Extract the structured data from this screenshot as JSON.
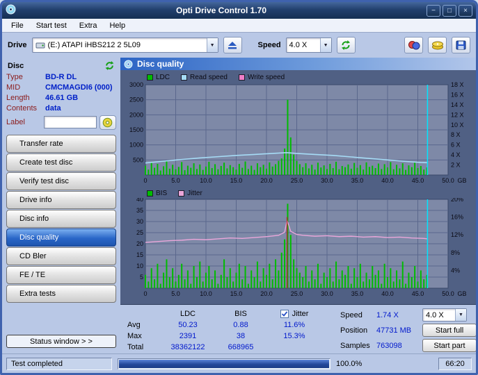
{
  "window": {
    "title": "Opti Drive Control 1.70",
    "minimize_glyph": "−",
    "maximize_glyph": "□",
    "close_glyph": "×"
  },
  "menu": {
    "items": [
      "File",
      "Start test",
      "Extra",
      "Help"
    ]
  },
  "toolbar": {
    "drive_label": "Drive",
    "drive_value": "(E:)  ATAPI iHBS212  2 5L09",
    "speed_label": "Speed",
    "speed_value": "4.0 X"
  },
  "sidebar": {
    "section_title": "Disc",
    "info": [
      {
        "label": "Type",
        "value": "BD-R DL"
      },
      {
        "label": "MID",
        "value": "CMCMAGDI6 (000)"
      },
      {
        "label": "Length",
        "value": "46.61 GB"
      },
      {
        "label": "Contents",
        "value": "data"
      }
    ],
    "label_caption": "Label",
    "label_value": "",
    "nav": [
      {
        "label": "Transfer rate",
        "active": false
      },
      {
        "label": "Create test disc",
        "active": false
      },
      {
        "label": "Verify test disc",
        "active": false
      },
      {
        "label": "Drive info",
        "active": false
      },
      {
        "label": "Disc info",
        "active": false
      },
      {
        "label": "Disc quality",
        "active": true
      },
      {
        "label": "CD Bler",
        "active": false
      },
      {
        "label": "FE / TE",
        "active": false
      },
      {
        "label": "Extra tests",
        "active": false
      }
    ],
    "status_window_label": "Status window > >"
  },
  "main": {
    "header": "Disc quality",
    "stats": {
      "col_headers": [
        "LDC",
        "BIS"
      ],
      "jitter_header": "Jitter",
      "jitter_checked": true,
      "rows": [
        {
          "label": "Avg",
          "ldc": "50.23",
          "bis": "0.88",
          "jitter": "11.6%"
        },
        {
          "label": "Max",
          "ldc": "2391",
          "bis": "38",
          "jitter": "15.3%"
        },
        {
          "label": "Total",
          "ldc": "38362122",
          "bis": "668965",
          "jitter": ""
        }
      ]
    },
    "controls": {
      "speed_label": "Speed",
      "speed_value": "1.74 X",
      "speed_select": "4.0 X",
      "position_label": "Position",
      "position_value": "47731 MB",
      "samples_label": "Samples",
      "samples_value": "763098",
      "start_full_label": "Start full",
      "start_part_label": "Start part"
    }
  },
  "statusbar": {
    "text": "Test completed",
    "progress_percent": "100.0%",
    "time": "66:20"
  },
  "chart_data": [
    {
      "type": "line",
      "title": "LDC / Read speed / Write speed vs disc position",
      "plot_bg": "#7e89a7",
      "grid_color": "#5a678c",
      "plot_border": "#39476a",
      "x_axis": {
        "min": 0,
        "max": 50,
        "ticks": [
          "0",
          "5.0",
          "10.0",
          "15.0",
          "20.0",
          "25.0",
          "30.0",
          "35.0",
          "40.0",
          "45.0",
          "50.0"
        ],
        "unit": "GB"
      },
      "y_left": {
        "min": 0,
        "max": 3000,
        "ticks": [
          500,
          1000,
          1500,
          2000,
          2500,
          3000
        ]
      },
      "y_right": [
        {
          "label": "18 X",
          "left": 3000
        },
        {
          "label": "16 X",
          "left": 2667
        },
        {
          "label": "14 X",
          "left": 2333
        },
        {
          "label": "12 X",
          "left": 2000
        },
        {
          "label": "10 X",
          "left": 1667
        },
        {
          "label": "8 X",
          "left": 1333
        },
        {
          "label": "6 X",
          "left": 1000
        },
        {
          "label": "4 X",
          "left": 667
        },
        {
          "label": "2 X",
          "left": 333
        }
      ],
      "series": [
        {
          "name": "LDC",
          "style": "spikes",
          "color": "#00bc00",
          "width": 2,
          "x_start": 0,
          "x_step": 0.5,
          "values": [
            310,
            180,
            420,
            240,
            370,
            150,
            290,
            450,
            210,
            340,
            190,
            270,
            430,
            160,
            310,
            240,
            390,
            200,
            350,
            170,
            280,
            440,
            230,
            360,
            190,
            300,
            410,
            220,
            330,
            260,
            180,
            370,
            240,
            450,
            200,
            310,
            170,
            390,
            260,
            340,
            210,
            420,
            280,
            360,
            470,
            550,
            880,
            2500,
            1250,
            680,
            470,
            360,
            260,
            390,
            220,
            340,
            180,
            410,
            250,
            320,
            200,
            370,
            230,
            440,
            190,
            300,
            260,
            350,
            210,
            400,
            240,
            330,
            180,
            420,
            270,
            310,
            230,
            380,
            200,
            360,
            250,
            430,
            190,
            340,
            220,
            390,
            170,
            320,
            260,
            410,
            230,
            300,
            180,
            250
          ]
        },
        {
          "name": "Read speed",
          "style": "line",
          "color": "#a6dcf6",
          "width": 1.6,
          "left_per_unit": 166.667,
          "points": [
            [
              0,
              2.4
            ],
            [
              3,
              2.75
            ],
            [
              6,
              3.1
            ],
            [
              9,
              3.4
            ],
            [
              12,
              3.65
            ],
            [
              15,
              3.9
            ],
            [
              18,
              4.1
            ],
            [
              21,
              4.3
            ],
            [
              23.3,
              4.45
            ],
            [
              25,
              4.3
            ],
            [
              28,
              4.1
            ],
            [
              31,
              3.9
            ],
            [
              34,
              3.6
            ],
            [
              37,
              3.3
            ],
            [
              40,
              3.0
            ],
            [
              43,
              2.7
            ],
            [
              45.5,
              2.5
            ],
            [
              46.6,
              2.45
            ]
          ]
        },
        {
          "name": "Write speed",
          "style": "line",
          "color": "#f07ec8",
          "width": 1.5,
          "points": []
        }
      ],
      "markers": [
        {
          "x": 46.6,
          "color": "#00e6ff",
          "height_frac": 1
        }
      ]
    },
    {
      "type": "line",
      "title": "BIS / Jitter vs disc position",
      "plot_bg": "#7e89a7",
      "grid_color": "#5a678c",
      "plot_border": "#39476a",
      "x_axis": {
        "min": 0,
        "max": 50,
        "ticks": [
          "0",
          "5.0",
          "10.0",
          "15.0",
          "20.0",
          "25.0",
          "30.0",
          "35.0",
          "40.0",
          "45.0",
          "50.0"
        ],
        "unit": "GB"
      },
      "y_left": {
        "min": 0,
        "max": 40,
        "ticks": [
          5,
          10,
          15,
          20,
          25,
          30,
          35,
          40
        ]
      },
      "y_right": [
        {
          "label": "20%",
          "left": 40
        },
        {
          "label": "16%",
          "left": 32
        },
        {
          "label": "12%",
          "left": 24
        },
        {
          "label": "8%",
          "left": 16
        },
        {
          "label": "4%",
          "left": 8
        }
      ],
      "series": [
        {
          "name": "BIS",
          "style": "spikes",
          "color": "#00bc00",
          "width": 2,
          "x_start": 0,
          "x_step": 0.5,
          "values": [
            6,
            3,
            9,
            4,
            11,
            2,
            7,
            13,
            5,
            9,
            3,
            6,
            11,
            4,
            8,
            2,
            10,
            5,
            12,
            3,
            7,
            10,
            4,
            8,
            2,
            6,
            13,
            5,
            9,
            3,
            7,
            11,
            4,
            10,
            2,
            8,
            5,
            12,
            3,
            9,
            6,
            11,
            4,
            13,
            8,
            16,
            22,
            38,
            24,
            13,
            9,
            7,
            5,
            10,
            3,
            8,
            4,
            11,
            2,
            7,
            5,
            9,
            3,
            12,
            4,
            8,
            6,
            10,
            2,
            9,
            5,
            11,
            3,
            7,
            4,
            10,
            6,
            8,
            2,
            11,
            5,
            9,
            3,
            8,
            4,
            12,
            2,
            7,
            5,
            10,
            3,
            8,
            4,
            6
          ]
        },
        {
          "name": "Jitter",
          "style": "line",
          "color": "#eaa6da",
          "width": 1.4,
          "left_per_unit": 2,
          "points": [
            [
              0,
              10.3
            ],
            [
              2,
              10.5
            ],
            [
              4,
              10.7
            ],
            [
              6,
              10.8
            ],
            [
              8,
              11.0
            ],
            [
              10,
              10.9
            ],
            [
              12,
              11.1
            ],
            [
              14,
              11.3
            ],
            [
              16,
              11.2
            ],
            [
              18,
              11.4
            ],
            [
              20,
              11.6
            ],
            [
              22,
              11.9
            ],
            [
              23,
              12.6
            ],
            [
              23.4,
              15.3
            ],
            [
              24,
              12.8
            ],
            [
              25,
              12.1
            ],
            [
              26,
              11.9
            ],
            [
              28,
              11.7
            ],
            [
              30,
              11.8
            ],
            [
              32,
              11.6
            ],
            [
              34,
              11.7
            ],
            [
              36,
              11.5
            ],
            [
              38,
              11.6
            ],
            [
              40,
              11.4
            ],
            [
              42,
              11.5
            ],
            [
              44,
              11.3
            ],
            [
              46,
              11.2
            ],
            [
              46.6,
              11.1
            ]
          ]
        }
      ],
      "markers": [
        {
          "x": 23.4,
          "color": "#aa2f2f",
          "height_frac": 0.8
        },
        {
          "x": 46.6,
          "color": "#00e6ff",
          "height_frac": 1
        }
      ]
    }
  ]
}
